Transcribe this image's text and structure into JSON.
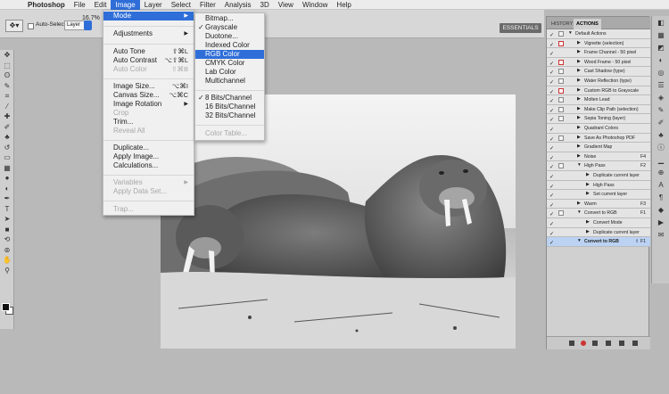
{
  "menubar": {
    "apple": "",
    "items": [
      "Photoshop",
      "File",
      "Edit",
      "Image",
      "Layer",
      "Select",
      "Filter",
      "Analysis",
      "3D",
      "View",
      "Window",
      "Help"
    ]
  },
  "options": {
    "auto_select_label": "Auto-Select:",
    "auto_select_value": "Layer",
    "zoom": "16.7%",
    "workspace": "ESSENTIALS"
  },
  "image_menu": {
    "mode": "Mode",
    "adjustments": "Adjustments",
    "auto_tone": "Auto Tone",
    "auto_tone_sc": "⇧⌘L",
    "auto_contrast": "Auto Contrast",
    "auto_contrast_sc": "⌥⇧⌘L",
    "auto_color": "Auto Color",
    "auto_color_sc": "⇧⌘B",
    "image_size": "Image Size...",
    "image_size_sc": "⌥⌘I",
    "canvas_size": "Canvas Size...",
    "canvas_size_sc": "⌥⌘C",
    "image_rotation": "Image Rotation",
    "crop": "Crop",
    "trim": "Trim...",
    "reveal_all": "Reveal All",
    "duplicate": "Duplicate...",
    "apply_image": "Apply Image...",
    "calculations": "Calculations...",
    "variables": "Variables",
    "apply_data_set": "Apply Data Set...",
    "trap": "Trap..."
  },
  "mode_menu": {
    "bitmap": "Bitmap...",
    "grayscale": "Grayscale",
    "duotone": "Duotone...",
    "indexed": "Indexed Color",
    "rgb": "RGB Color",
    "cmyk": "CMYK Color",
    "lab": "Lab Color",
    "multichannel": "Multichannel",
    "bits8": "8 Bits/Channel",
    "bits16": "16 Bits/Channel",
    "bits32": "32 Bits/Channel",
    "color_table": "Color Table..."
  },
  "panel": {
    "tab_history": "HISTORY",
    "tab_actions": "ACTIONS",
    "actions": [
      {
        "label": "Default Actions",
        "fkey": ""
      },
      {
        "label": "Vignette (selection)",
        "fkey": ""
      },
      {
        "label": "Frame Channel - 50 pixel",
        "fkey": ""
      },
      {
        "label": "Wood Frame - 50 pixel",
        "fkey": ""
      },
      {
        "label": "Cast Shadow (type)",
        "fkey": ""
      },
      {
        "label": "Water Reflection (type)",
        "fkey": ""
      },
      {
        "label": "Custom RGB to Grayscale",
        "fkey": ""
      },
      {
        "label": "Molten Lead",
        "fkey": ""
      },
      {
        "label": "Make Clip Path (selection)",
        "fkey": ""
      },
      {
        "label": "Sepia Toning (layer)",
        "fkey": ""
      },
      {
        "label": "Quadrant Colors",
        "fkey": ""
      },
      {
        "label": "Save As Photoshop PDF",
        "fkey": ""
      },
      {
        "label": "Gradient Map",
        "fkey": ""
      },
      {
        "label": "Noise",
        "fkey": "F4"
      },
      {
        "label": "High Pass",
        "fkey": "F2"
      },
      {
        "label": "Duplicate current layer",
        "fkey": ""
      },
      {
        "label": "High Pass",
        "fkey": ""
      },
      {
        "label": "Set current layer",
        "fkey": ""
      },
      {
        "label": "Warm",
        "fkey": "F3"
      },
      {
        "label": "Convert to RGB",
        "fkey": "F1"
      },
      {
        "label": "Convert Mode",
        "fkey": ""
      },
      {
        "label": "Duplicate current layer",
        "fkey": ""
      },
      {
        "label": "Convert to RGB",
        "fkey": "⇧ F1"
      }
    ]
  }
}
